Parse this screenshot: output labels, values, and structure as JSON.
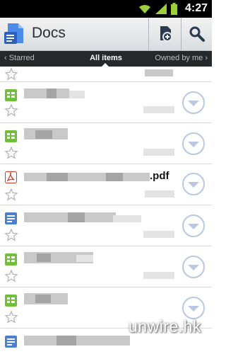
{
  "status_bar": {
    "time": "4:27"
  },
  "app_bar": {
    "title": "Docs",
    "icons": [
      "docs-logo-icon",
      "new-document-icon",
      "search-icon"
    ]
  },
  "tabs": {
    "left": "‹ Starred",
    "center": "All items",
    "right": "Owned by me ›"
  },
  "rows": [
    {
      "type": "partial",
      "name": ""
    },
    {
      "type": "spreadsheet",
      "name": ""
    },
    {
      "type": "spreadsheet",
      "name": ""
    },
    {
      "type": "pdf",
      "name": ".pdf"
    },
    {
      "type": "document",
      "name": ""
    },
    {
      "type": "spreadsheet",
      "name": ""
    },
    {
      "type": "spreadsheet",
      "name": ""
    },
    {
      "type": "document",
      "name": ""
    }
  ],
  "watermark": "unwire.hk"
}
